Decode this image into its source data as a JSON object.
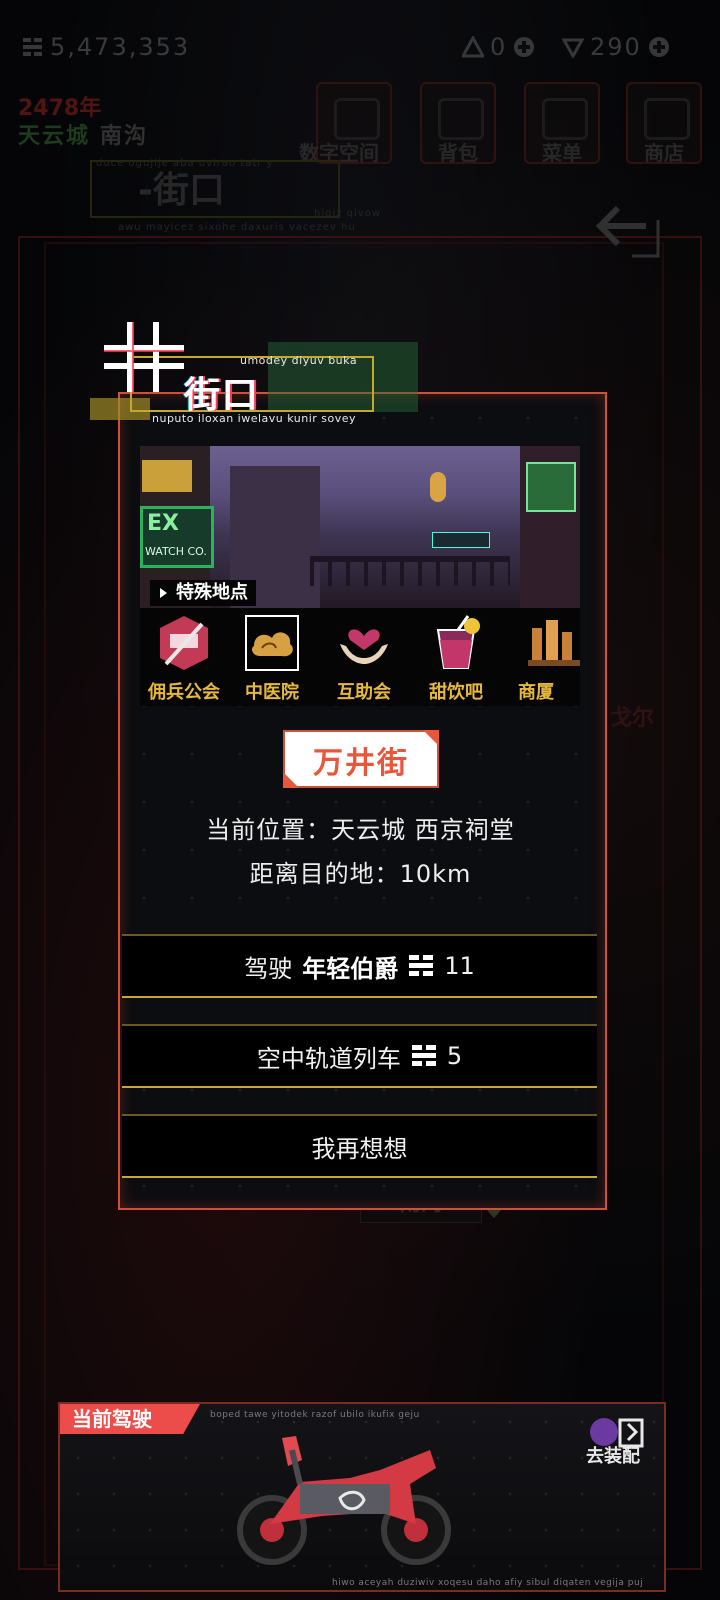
{
  "top_bar": {
    "currency_main": "5,473,353",
    "currency_gem": "0",
    "currency_shard": "290",
    "year": "2478年",
    "city": "天云城",
    "district": "南沟",
    "buttons": [
      {
        "label": "数字空间"
      },
      {
        "label": "背包"
      },
      {
        "label": "菜单"
      },
      {
        "label": "商店"
      }
    ],
    "location_back": "-街口",
    "location_noise_top": "duce ogujije aba uvirao tatr y",
    "location_noise_bottom": "awu mayicez sixohe daxuris vacezev hu",
    "location_noise_right": "higiz qivow"
  },
  "background": {
    "map_label": "南沟",
    "side_label": "戈尔"
  },
  "dialog": {
    "title": "街口",
    "subtitle_top": "umodey diyuv buka",
    "subtitle_bottom": "nuputo iloxan iwelavu kunir sovey",
    "photo_sign_main": "EX",
    "photo_sign_sub": "WATCH CO.",
    "special_places_label": "特殊地点",
    "places": [
      {
        "name": "佣兵公会",
        "icon": "mercenary-guild-icon"
      },
      {
        "name": "中医院",
        "icon": "chinese-hospital-icon"
      },
      {
        "name": "互助会",
        "icon": "mutual-aid-icon"
      },
      {
        "name": "甜饮吧",
        "icon": "sweet-drink-bar-icon"
      },
      {
        "name": "商厦",
        "icon": "mall-icon"
      }
    ],
    "street_name": "万井街",
    "current_position": "当前位置：天云城 西京祠堂",
    "distance": "距离目的地：10km",
    "options": {
      "drive": {
        "prefix": "驾驶",
        "vehicle": "年轻伯爵",
        "cost": "11"
      },
      "train": {
        "label": "空中轨道列车",
        "cost": "5"
      },
      "cancel": {
        "label": "我再想想"
      }
    }
  },
  "bottom_panel": {
    "tag": "当前驾驶",
    "noise_top": "boped tawe yitodek razof ubilo ikufix geju",
    "noise_bottom": "hiwo aceyah duziwiv xoqesu daho afiy sibul diqaten vegija puj",
    "equip_label": "去装配"
  },
  "colors": {
    "accent_red": "#e8563c",
    "gold": "#e7b93a",
    "frame": "#d0513b"
  }
}
